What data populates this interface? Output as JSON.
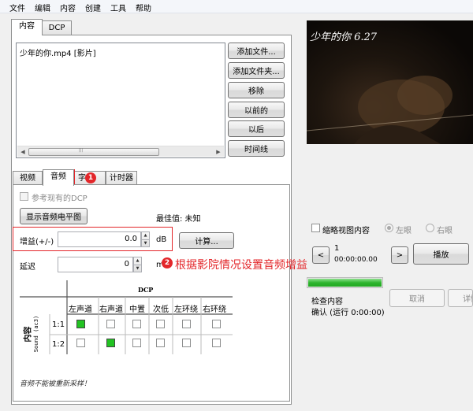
{
  "menubar": {
    "items": [
      "文件",
      "编辑",
      "内容",
      "创建",
      "工具",
      "帮助"
    ]
  },
  "top_tabs": {
    "tabs": [
      {
        "label": "内容",
        "active": true
      },
      {
        "label": "DCP",
        "active": false
      }
    ]
  },
  "content_list": {
    "items": [
      "少年的你.mp4 [影片]"
    ]
  },
  "content_buttons": {
    "add_file": "添加文件...",
    "add_folder": "添加文件夹...",
    "remove": "移除",
    "earlier": "以前的",
    "later": "以后",
    "timeline": "时间线"
  },
  "sub_tabs": {
    "tabs": [
      {
        "label": "视频",
        "active": false
      },
      {
        "label": "音频",
        "active": true
      },
      {
        "label": "字",
        "active": false
      },
      {
        "label": "计时器",
        "active": false
      }
    ]
  },
  "audio": {
    "use_existing_dcp": "参考现有的DCP",
    "show_levels_button": "显示音频电平图",
    "best_value_label": "最佳值: 未知",
    "gain_label": "增益(+/-)",
    "gain_value": "0.0",
    "gain_unit": "dB",
    "calculate_button": "计算...",
    "delay_label": "延迟",
    "delay_value": "0",
    "delay_unit": "ms",
    "resample_note": "音频不能被重新采样！"
  },
  "mapping": {
    "dcp_header": "DCP",
    "content_header": "内容",
    "sound_label": "Sound (ac3)",
    "columns": [
      "左声道",
      "右声道",
      "中置",
      "次低",
      "左环绕",
      "右环绕"
    ],
    "rows": [
      {
        "label": "1:1",
        "checked": [
          true,
          false,
          false,
          false,
          false,
          false
        ]
      },
      {
        "label": "1:2",
        "checked": [
          false,
          true,
          false,
          false,
          false,
          false
        ]
      }
    ]
  },
  "annotations": {
    "badge1": "1",
    "badge2": "2",
    "instruction": "根据影院情况设置音频增益",
    "red": "#e3262a"
  },
  "preview": {
    "watermark": "少年的你 6.27",
    "outline_content": "缩略视图内容",
    "left_eye": "左眼",
    "right_eye": "右眼",
    "prev_button": "<",
    "next_button": ">",
    "frame": "1",
    "timecode": "00:00:00.00",
    "play_button": "播放",
    "progress": 1.0,
    "check_content": "检查内容",
    "confirm_text": "确认 (运行 0:00:00)",
    "cancel_button": "取消",
    "details_button": "详情"
  },
  "colors": {
    "green": "#22c322",
    "progress_green": "#2fb52f"
  }
}
